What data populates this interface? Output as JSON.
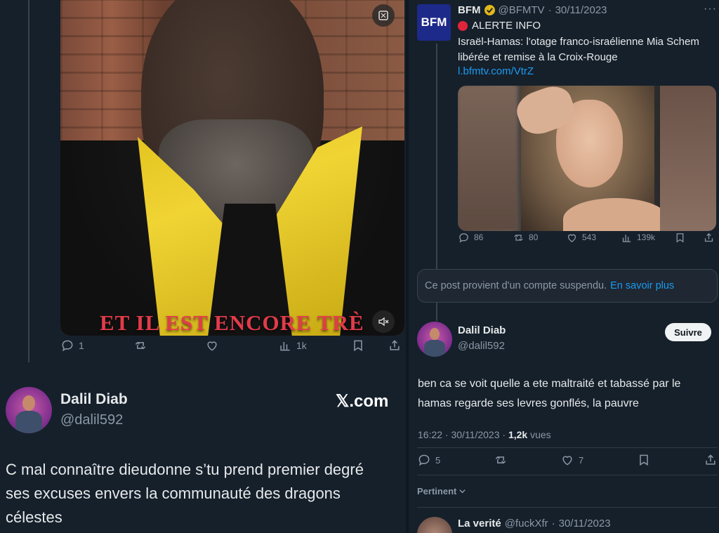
{
  "left_tweet": {
    "video_caption": "ET IL EST ENCORE TRÈ",
    "actions": {
      "replies": "1",
      "reposts": "",
      "likes": "",
      "views": "1k"
    },
    "author": {
      "name": "Dalil Diab",
      "handle": "@dalil592"
    },
    "watermark": "𝕏.com",
    "text": "C mal connaître dieudonne s’tu prend premier degré ses excuses envers la communauté des dragons célestes"
  },
  "quoted_post": {
    "logo_text": "BFM",
    "author": "BFM",
    "handle": "@BFMTV",
    "date": "30/11/2023",
    "alert": "ALERTE INFO",
    "headline": "Israël-Hamas: l'otage franco-israélienne Mia Schem libérée et remise à la Croix-Rouge",
    "link": "l.bfmtv.com/VtrZ",
    "actions": {
      "replies": "86",
      "reposts": "80",
      "likes": "543",
      "views": "139k"
    }
  },
  "suspended_notice": {
    "text": "Ce post provient d'un compte suspendu.",
    "link": "En savoir plus"
  },
  "reply": {
    "author": {
      "name": "Dalil Diab",
      "handle": "@dalil592"
    },
    "follow_label": "Suivre",
    "text": "ben ca se voit quelle a ete maltraité et tabassé par le hamas regarde ses levres gonflés, la pauvre",
    "time": "16:22 · 30/11/2023 · ",
    "views_count": "1,2k",
    "views_label": " vues",
    "actions": {
      "replies": "5",
      "reposts": "",
      "likes": "7"
    },
    "sort_label": "Pertinent"
  },
  "next_reply": {
    "author": "La verité",
    "handle": "@fuckXfr",
    "date": "30/11/2023"
  },
  "colors": {
    "background": "#15202b",
    "accent": "#1d9bf0",
    "caption": "#e23b4a",
    "bfm_blue": "#1d2a8a"
  }
}
